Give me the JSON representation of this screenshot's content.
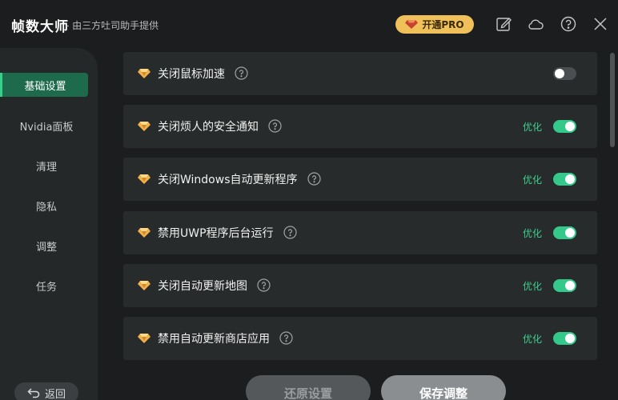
{
  "window": {
    "title": "帧数大师",
    "subtitle": "- 由三方吐司助手提供",
    "pro_label": "开通PRO"
  },
  "colors": {
    "accent": "#36d08a",
    "pro_gold": "#f0c05a",
    "background": "#1b1d1e"
  },
  "titlebar_icons": [
    "edit-icon",
    "cloud-icon",
    "help-icon",
    "close-icon"
  ],
  "sidebar": {
    "items": [
      {
        "label": "基础设置",
        "active": true
      },
      {
        "label": "Nvidia面板",
        "active": false
      },
      {
        "label": "清理",
        "active": false
      },
      {
        "label": "隐私",
        "active": false
      },
      {
        "label": "调整",
        "active": false
      },
      {
        "label": "任务",
        "active": false
      }
    ],
    "back_label": "返回"
  },
  "settings": [
    {
      "label": "关闭鼠标加速",
      "status": "",
      "enabled": false
    },
    {
      "label": "关闭烦人的安全通知",
      "status": "优化",
      "enabled": true
    },
    {
      "label": "关闭Windows自动更新程序",
      "status": "优化",
      "enabled": true
    },
    {
      "label": "禁用UWP程序后台运行",
      "status": "优化",
      "enabled": true
    },
    {
      "label": "关闭自动更新地图",
      "status": "优化",
      "enabled": true
    },
    {
      "label": "禁用自动更新商店应用",
      "status": "优化",
      "enabled": true
    }
  ],
  "footer": {
    "restore_label": "还原设置",
    "save_label": "保存调整"
  }
}
